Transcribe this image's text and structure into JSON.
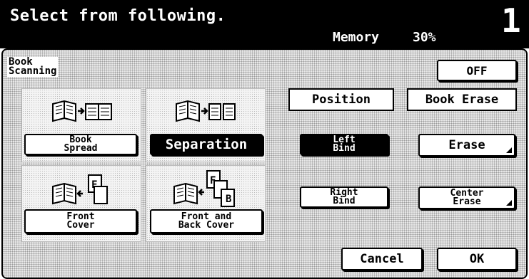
{
  "header": {
    "title": "Select from following.",
    "memory_label": "Memory",
    "memory_value": "30%",
    "copy_count": "1"
  },
  "panel": {
    "mode_label": "Book\nScanning",
    "off_button": "OFF"
  },
  "modes": {
    "book_spread": "Book\nSpread",
    "separation": "Separation",
    "front_cover": "Front\nCover",
    "front_back_cover": "Front and\nBack Cover"
  },
  "position": {
    "heading": "Position",
    "left_bind": "Left\nBind",
    "right_bind": "Right\nBind"
  },
  "book_erase": {
    "heading": "Book Erase",
    "erase": "Erase",
    "center_erase": "Center\nErase"
  },
  "footer": {
    "cancel": "Cancel",
    "ok": "OK"
  },
  "icons": [
    "book-spread-icon",
    "separation-icon",
    "front-cover-icon",
    "front-back-cover-icon"
  ]
}
